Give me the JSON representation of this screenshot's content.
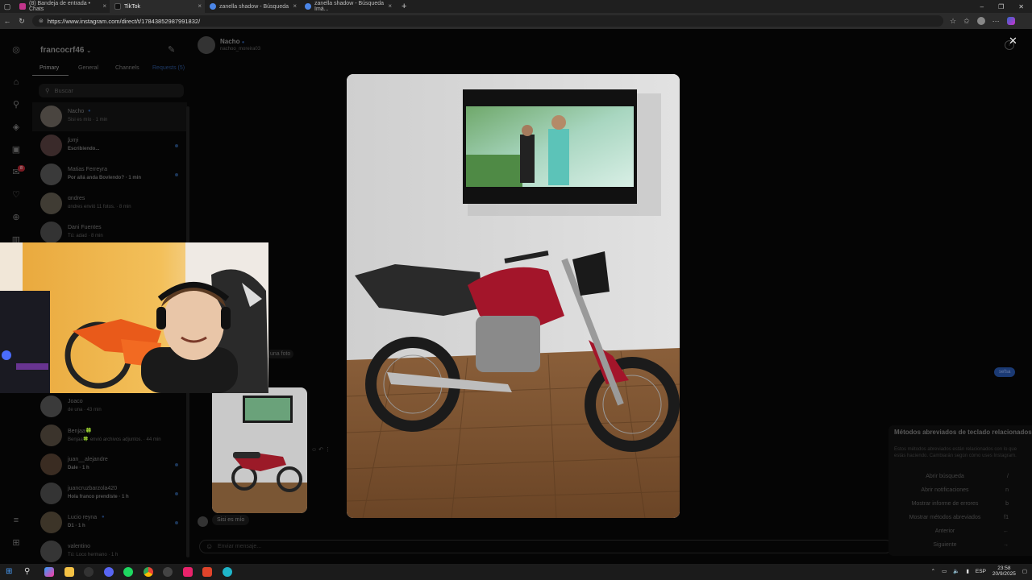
{
  "browser": {
    "tabs": [
      {
        "title": "(8) Bandeja de entrada • Chats",
        "active": false
      },
      {
        "title": "TikTok",
        "active": true
      },
      {
        "title": "zanella shadow - Búsqueda",
        "active": false
      },
      {
        "title": "zanella shadow - Búsqueda Imá...",
        "active": false
      }
    ],
    "url": "https://www.instagram.com/direct/t/17843852987991832/"
  },
  "instagram": {
    "username": "francocrf46",
    "filter_tabs": [
      "Primary",
      "General",
      "Channels",
      "Requests (5)"
    ],
    "search_placeholder": "Buscar",
    "notification_badge": "8",
    "chats_top": [
      {
        "name": "Nacho",
        "preview": "Sisi es mío · 1 min",
        "selected": true,
        "unread": false
      },
      {
        "name": "ʄʊɱɨ",
        "preview": "Escribiendo...",
        "selected": false,
        "unread": true
      },
      {
        "name": "Matias Ferreyra",
        "preview": "Por allá anda Bovlendo? · 1 min",
        "selected": false,
        "unread": true
      },
      {
        "name": "ɑndres",
        "preview": "ɑndres envió 11 fotos. · 8 min",
        "selected": false,
        "unread": false
      },
      {
        "name": "Dani Fuentes",
        "preview": "Tú: adad · 8 min",
        "selected": false,
        "unread": false
      }
    ],
    "chats_bottom": [
      {
        "name": "Joaco",
        "preview": "de una · 43 min",
        "unread": false
      },
      {
        "name": "Benjaa🍀",
        "preview": "Benjaa🍀 envió archivos adjuntos. · 44 min",
        "unread": false
      },
      {
        "name": "juan__alejandre",
        "preview": "Dale · 1 h",
        "unread": true
      },
      {
        "name": "juancruzbarzola420",
        "preview": "Hola franco prendiste · 1 h",
        "unread": true
      },
      {
        "name": "Lucio reyna",
        "preview": "D1 · 1 h",
        "unread": true
      },
      {
        "name": "valentino",
        "preview": "Tú: Loco hermano · 1 h",
        "unread": false
      }
    ],
    "conversation": {
      "name": "Nacho",
      "handle": "nachoo_moreira03",
      "sent_photo_label": "una foto",
      "reply": "Sisi es mío",
      "composer_placeholder": "Enviar mensaje...",
      "blue_bubble": "sefsa"
    },
    "shortcuts": {
      "title": "Métodos abreviados de teclado relacionados",
      "description": "Estos métodos abreviados están relacionados con lo que estás haciendo. Cambiarán según cómo uses Instagram.",
      "items": [
        {
          "label": "Abrir búsqueda",
          "key": "/"
        },
        {
          "label": "Abrir notificaciones",
          "key": "n"
        },
        {
          "label": "Mostrar informe de errores",
          "key": "b"
        },
        {
          "label": "Mostrar métodos abreviados",
          "key": "f1"
        },
        {
          "label": "Anterior",
          "key": "←"
        },
        {
          "label": "Siguiente",
          "key": "→"
        }
      ]
    }
  },
  "taskbar": {
    "lang": "ESP",
    "time": "23:58",
    "date": "20/9/2025"
  },
  "colors": {
    "accent_blue": "#0095f6",
    "moto_red": "#a3152a"
  }
}
